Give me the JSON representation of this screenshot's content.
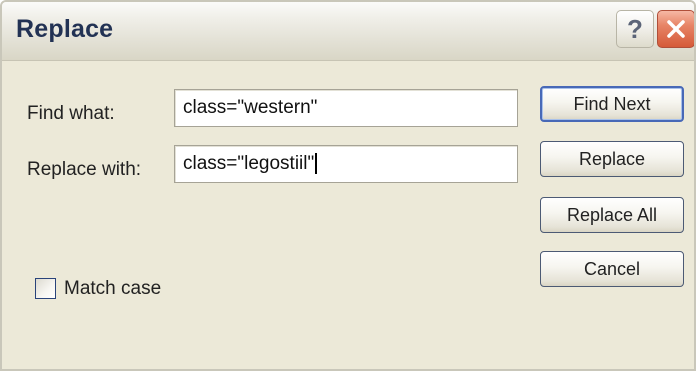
{
  "window": {
    "title": "Replace",
    "help_label": "?",
    "help_icon": "question-mark-icon",
    "close_icon": "close-x-icon"
  },
  "form": {
    "find_label": "Find what:",
    "find_value": "class=\"western\"",
    "replace_label": "Replace with:",
    "replace_value": "class=\"legostiil\"",
    "match_case_label": "Match case",
    "match_case_checked": false
  },
  "buttons": {
    "find_next": "Find Next",
    "replace": "Replace",
    "replace_all": "Replace All",
    "cancel": "Cancel"
  },
  "colors": {
    "dialog_bg": "#ece9d8",
    "title_text": "#223254",
    "close_button": "#d55a39",
    "default_button_border": "#4869b7"
  }
}
